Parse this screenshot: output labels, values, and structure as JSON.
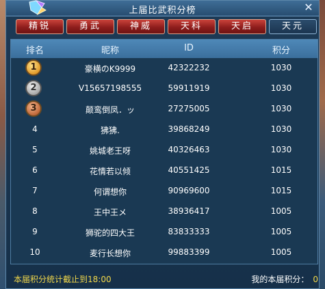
{
  "window": {
    "title": "上届比武积分榜",
    "close_label": "✕"
  },
  "tabs": [
    {
      "label": "精锐",
      "active": false
    },
    {
      "label": "勇武",
      "active": false
    },
    {
      "label": "神威",
      "active": false
    },
    {
      "label": "天科",
      "active": false
    },
    {
      "label": "天启",
      "active": false
    },
    {
      "label": "天元",
      "active": true
    }
  ],
  "table": {
    "headers": [
      "排名",
      "昵称",
      "ID",
      "积分"
    ],
    "rows": [
      {
        "rank": "1",
        "name": "豪横のK9999",
        "id": "42322232",
        "score": "1030"
      },
      {
        "rank": "2",
        "name": "V15657198555",
        "id": "59911919",
        "score": "1030"
      },
      {
        "rank": "3",
        "name": "颠鸾倒凤．ッ",
        "id": "27275005",
        "score": "1030"
      },
      {
        "rank": "4",
        "name": "狒狒.",
        "id": "39868249",
        "score": "1030"
      },
      {
        "rank": "5",
        "name": "姚城老王呀",
        "id": "40326463",
        "score": "1030"
      },
      {
        "rank": "6",
        "name": "花情若以倾",
        "id": "40551425",
        "score": "1015"
      },
      {
        "rank": "7",
        "name": "何谓想你",
        "id": "90969600",
        "score": "1015"
      },
      {
        "rank": "8",
        "name": "王中王メ",
        "id": "38936417",
        "score": "1005"
      },
      {
        "rank": "9",
        "name": "狮驼的四大王",
        "id": "83833333",
        "score": "1005"
      },
      {
        "rank": "10",
        "name": "麦行长想你",
        "id": "99883399",
        "score": "1005"
      }
    ]
  },
  "footer": {
    "deadline_text": "本届积分统计截止到18:00",
    "my_score_label": "我的本届积分：",
    "my_score_value": "0"
  }
}
